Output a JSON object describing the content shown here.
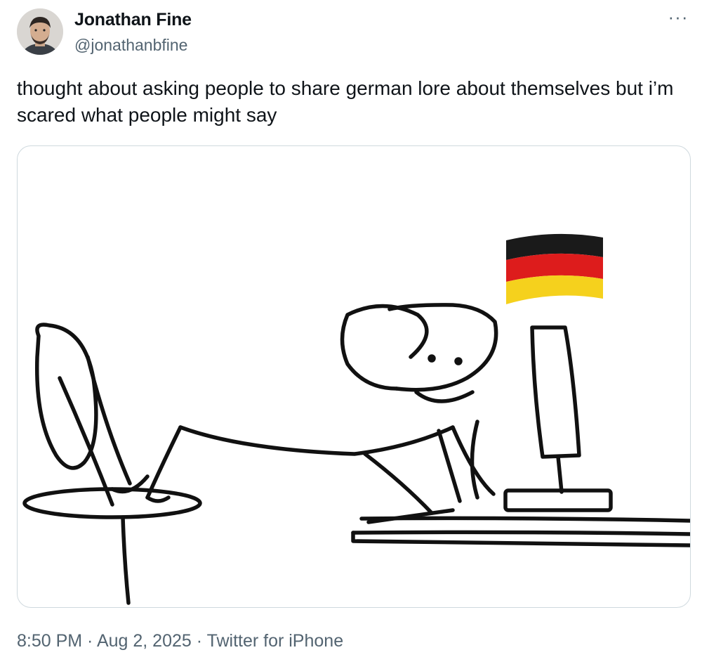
{
  "author": {
    "display_name": "Jonathan Fine",
    "handle": "@jonathanbfine"
  },
  "menu": {
    "more_icon": "more-horizontal-icon",
    "more_label": "···"
  },
  "tweet": {
    "text": "thought about asking people to share german lore about themselves but i’m scared what people might say"
  },
  "media": {
    "description_icon": "stickman-computer-meme",
    "flag": "germany-flag",
    "flag_colors": [
      "#1a1a1a",
      "#dd1c1c",
      "#f5d11d"
    ]
  },
  "meta": {
    "time": "8:50 PM",
    "separator_1": " · ",
    "date": "Aug 2, 2025",
    "separator_2": " · ",
    "source": "Twitter for iPhone"
  },
  "colors": {
    "text_primary": "#0f1419",
    "text_secondary": "#536471",
    "border": "#cfd9de"
  }
}
